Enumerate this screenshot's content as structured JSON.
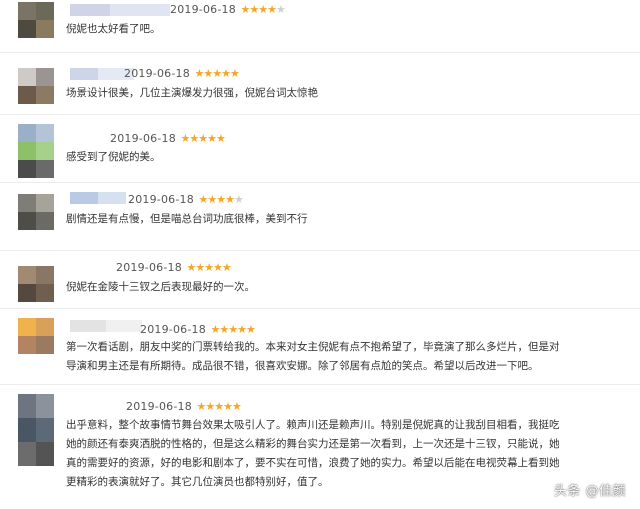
{
  "reviews": [
    {
      "date": "2019-06-18",
      "rating": 4,
      "text": [
        "倪妮也太好看了吧。"
      ]
    },
    {
      "date": "2019-06-18",
      "rating": 5,
      "text": [
        "场景设计很美，几位主演爆发力很强，倪妮台词太惊艳"
      ]
    },
    {
      "date": "2019-06-18",
      "rating": 5,
      "text": [
        "感受到了倪妮的美。"
      ]
    },
    {
      "date": "2019-06-18",
      "rating": 4,
      "text": [
        "剧情还是有点慢，但是喵总台词功底很棒，美到不行"
      ]
    },
    {
      "date": "2019-06-18",
      "rating": 5,
      "text": [
        "倪妮在金陵十三钗之后表现最好的一次。"
      ]
    },
    {
      "date": "2019-06-18",
      "rating": 5,
      "text": [
        "第一次看话剧，朋友中奖的门票转给我的。本来对女主倪妮有点不抱希望了，毕竟演了那么多烂片，但是对",
        "导演和男主还是有所期待。成品很不错，很喜欢安娜。除了邻居有点尬的笑点。希望以后改进一下吧。"
      ]
    },
    {
      "date": "2019-06-18",
      "rating": 5,
      "text": [
        "出乎意料，整个故事情节舞台效果太吸引人了。赖声川还是赖声川。特别是倪妮真的让我刮目相看，我挺吃",
        "她的颜还有泰爽洒脱的性格的，但是这么精彩的舞台实力还是第一次看到，上一次还是十三钗，只能说，她",
        "真的需要好的资源，好的电影和剧本了，要不实在可惜，浪费了她的实力。希望以后能在电视荧幕上看到她",
        "更精彩的表演就好了。其它几位演员也都特别好，值了。"
      ]
    }
  ],
  "watermark": "头条 @佳颜",
  "colors": {
    "star": "#f5a623",
    "star_off": "#cfcfcf",
    "text": "#333333"
  }
}
